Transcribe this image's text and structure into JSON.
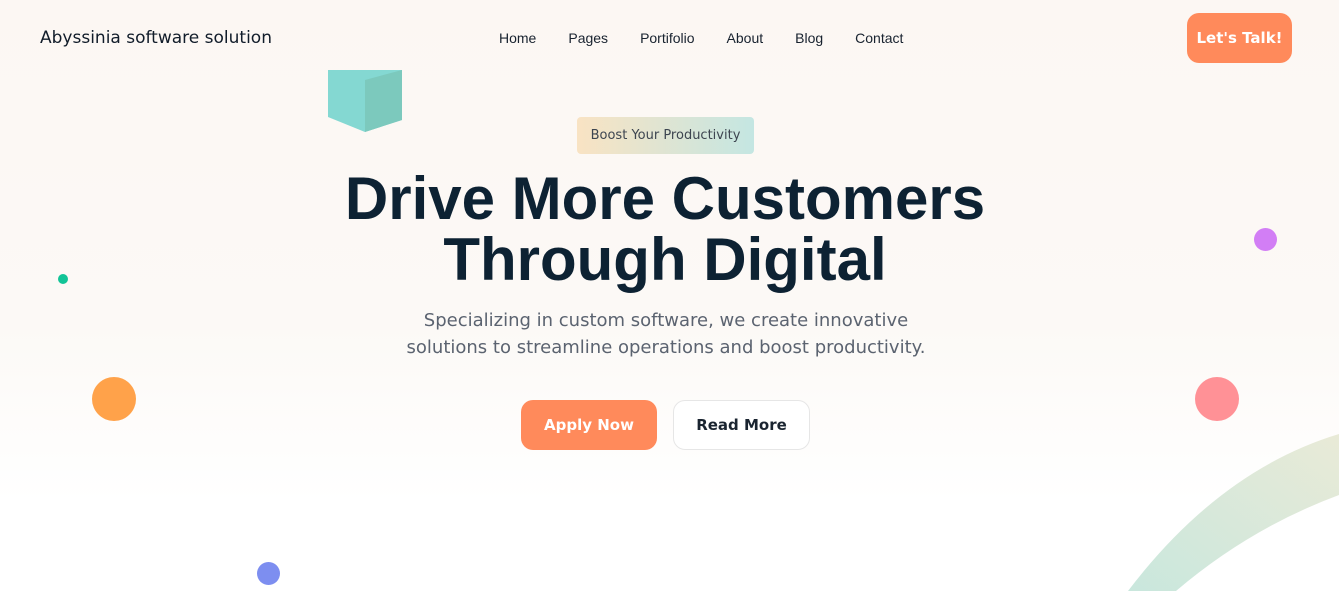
{
  "header": {
    "brand": "Abyssinia software solution",
    "nav": [
      "Home",
      "Pages",
      "Portifolio",
      "About",
      "Blog",
      "Contact"
    ],
    "cta_label": "Let's Talk!"
  },
  "hero": {
    "badge": "Boost Your Productivity",
    "headline_line1": "Drive More Customers",
    "headline_line2": "Through Digital",
    "subtitle_line1": "Specializing in custom software, we create innovative",
    "subtitle_line2": "solutions to streamline operations and boost productivity.",
    "primary_button": "Apply Now",
    "secondary_button": "Read More"
  },
  "colors": {
    "accent": "#ff8a5b",
    "headline": "#0d2233",
    "text_muted": "#5b6370"
  },
  "icons": [
    "cube-shape",
    "green-dot",
    "orange-dot",
    "blue-dot",
    "purple-dot",
    "pink-dot",
    "decorative-arc"
  ]
}
